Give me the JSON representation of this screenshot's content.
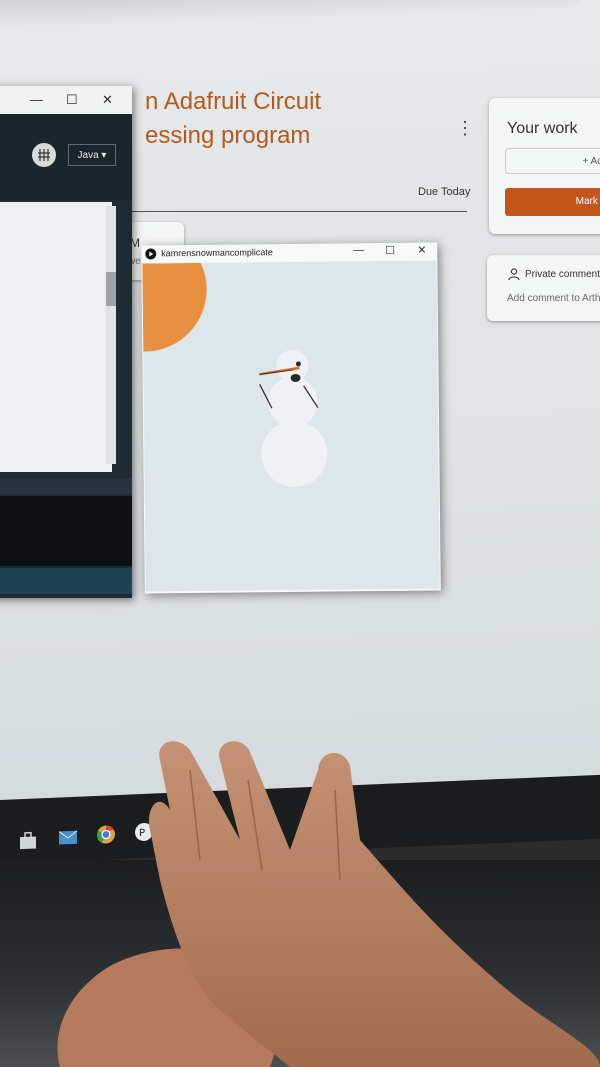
{
  "assignment": {
    "title_line1": "n Adafruit Circuit",
    "title_line2": "essing program",
    "due": "Due Today",
    "partial_label_1": "M",
    "partial_label_2": "we"
  },
  "your_work": {
    "title": "Your work",
    "add_label": "+ Add or",
    "mark_label": "Mark as c"
  },
  "private_comments": {
    "label": "Private comment",
    "add_label": "Add comment to Arth"
  },
  "ide": {
    "mode": "Java ▾",
    "minimize": "—",
    "maximize": "☐",
    "close": "✕"
  },
  "sketch": {
    "title": "kamrensnowmancomplicate",
    "minimize": "—",
    "maximize": "☐",
    "close": "✕"
  },
  "colors": {
    "accent": "#c2561b",
    "sun": "#e8903f",
    "sky": "#dde6ea",
    "ide_dark": "#1f2a32"
  }
}
